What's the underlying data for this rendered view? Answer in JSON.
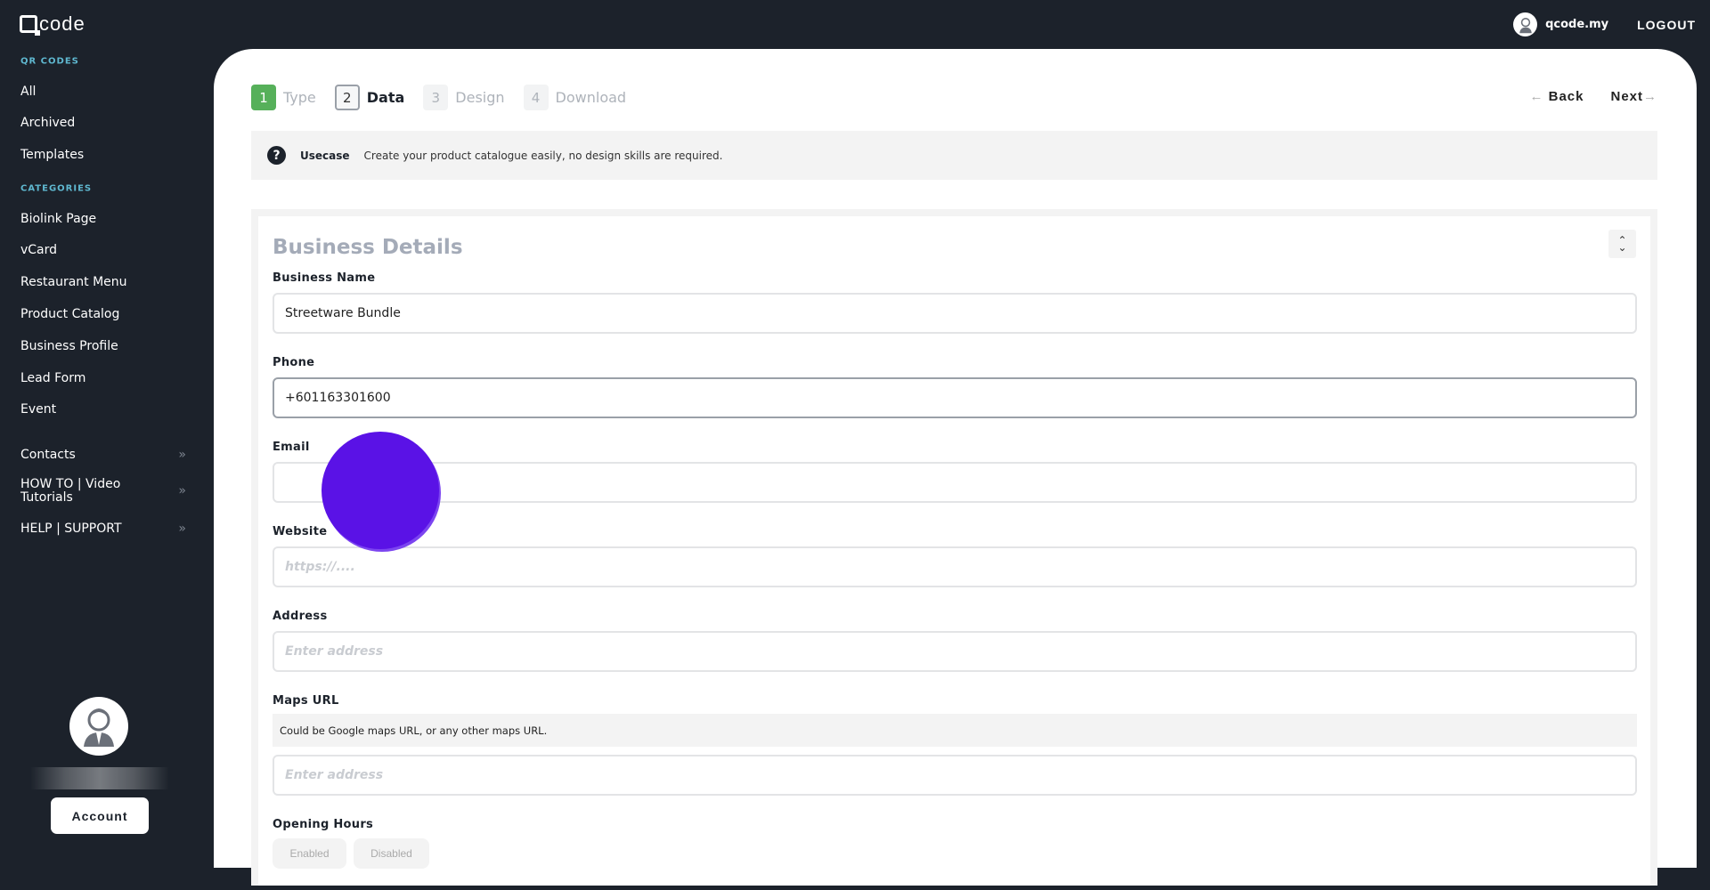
{
  "brand": {
    "logo_text": "code"
  },
  "topbar": {
    "username": "qcode.my",
    "logout": "LOGOUT"
  },
  "sidebar": {
    "qr_heading": "QR CODES",
    "qr_items": [
      {
        "label": "All"
      },
      {
        "label": "Archived"
      },
      {
        "label": "Templates"
      }
    ],
    "cat_heading": "CATEGORIES",
    "cat_items": [
      {
        "label": "Biolink Page"
      },
      {
        "label": "vCard"
      },
      {
        "label": "Restaurant Menu"
      },
      {
        "label": "Product Catalog"
      },
      {
        "label": "Business Profile"
      },
      {
        "label": "Lead Form"
      },
      {
        "label": "Event"
      }
    ],
    "extra_items": [
      {
        "label": "Contacts"
      },
      {
        "label": "HOW TO | Video Tutorials"
      },
      {
        "label": "HELP | SUPPORT"
      }
    ],
    "chevron": "»",
    "account": "Account"
  },
  "steps": [
    {
      "num": "1",
      "label": "Type"
    },
    {
      "num": "2",
      "label": "Data"
    },
    {
      "num": "3",
      "label": "Design"
    },
    {
      "num": "4",
      "label": "Download"
    }
  ],
  "nav": {
    "back": "Back",
    "next": "Next",
    "back_arrow": "←",
    "next_arrow": "→"
  },
  "usecase": {
    "icon": "?",
    "label": "Usecase",
    "text": "Create your product catalogue easily, no design skills are required."
  },
  "form": {
    "title": "Business Details",
    "business_name": {
      "label": "Business Name",
      "value": "Streetware Bundle"
    },
    "phone": {
      "label": "Phone",
      "value": "+601163301600"
    },
    "email": {
      "label": "Email",
      "value": ""
    },
    "website": {
      "label": "Website",
      "placeholder": "https://...."
    },
    "address": {
      "label": "Address",
      "placeholder": "Enter address"
    },
    "maps": {
      "label": "Maps URL",
      "hint": "Could be Google maps URL, or any other maps URL.",
      "placeholder": "Enter address"
    },
    "hours": {
      "label": "Opening Hours",
      "enabled": "Enabled",
      "disabled": "Disabled"
    }
  },
  "colors": {
    "accent_green": "#56b05a",
    "sidebar_bg": "#1c222b",
    "cursor": "#5a12e6"
  }
}
